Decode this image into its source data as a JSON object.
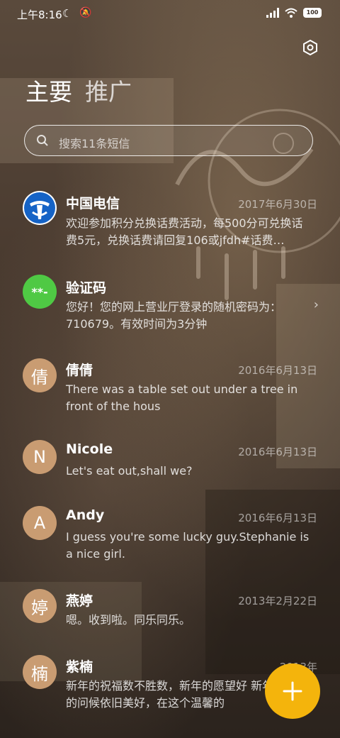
{
  "status": {
    "time": "上午8:16",
    "battery": "100"
  },
  "tabs": [
    {
      "label": "主要"
    },
    {
      "label": "推广"
    }
  ],
  "search": {
    "placeholder": "搜索11条短信"
  },
  "conversations": [
    {
      "sender": "中国电信",
      "date": "2017年6月30日",
      "preview": "欢迎参加积分兑换话费活动，每500分可兑换话费5元，兑换话费请回复106或jfdh#话费…",
      "avatar": "telecom-logo"
    },
    {
      "sender": "验证码",
      "date": "",
      "preview": "您好！您的网上营业厅登录的随机密码为：710679。有效时间为3分钟",
      "avatar": "**-",
      "avatar_color": "#4fc944"
    },
    {
      "sender": "倩倩",
      "date": "2016年6月13日",
      "preview": "There was a table set out under a tree in front of the hous",
      "avatar": "倩"
    },
    {
      "sender": "Nicole",
      "date": "2016年6月13日",
      "preview": "Let's eat out,shall we?",
      "avatar": "N"
    },
    {
      "sender": "Andy",
      "date": "2016年6月13日",
      "preview": "I guess you're some lucky guy.Stephanie is a nice girl.",
      "avatar": "A"
    },
    {
      "sender": "燕婷",
      "date": "2013年2月22日",
      "preview": "嗯。收到啦。同乐同乐。",
      "avatar": "婷"
    },
    {
      "sender": "紫楠",
      "date": "2013年",
      "preview": "新年的祝福数不胜数，新年的愿望好 新年的问候依旧美好，在这个温馨的",
      "avatar": "楠"
    }
  ],
  "colors": {
    "accent": "#f4b40c",
    "avatar_letter": "#c99c72",
    "telecom_blue": "#1563c6"
  }
}
